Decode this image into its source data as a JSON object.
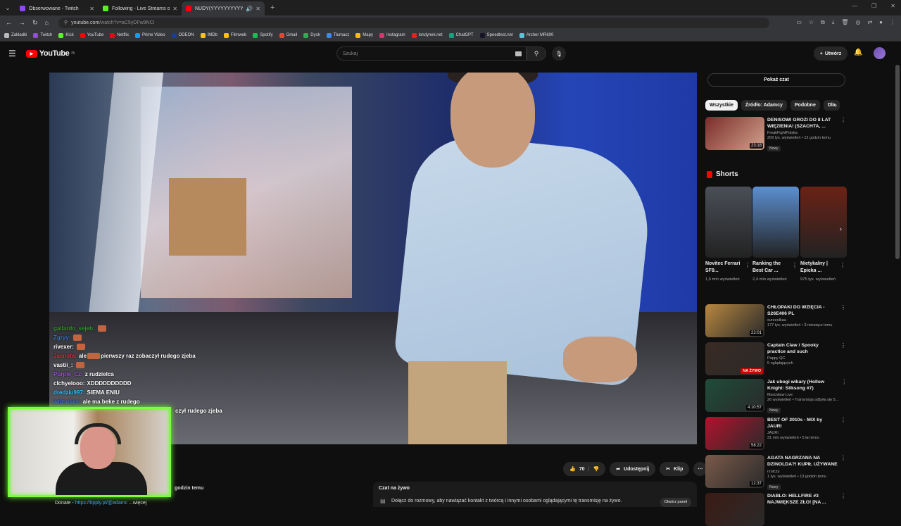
{
  "browser": {
    "tabs": [
      {
        "title": "Obserwowane - Twitch",
        "color": "#9146ff",
        "active": false
      },
      {
        "title": "Following - Live Streams on Kick",
        "color": "#53fc18",
        "active": false
      },
      {
        "title": "NUDY(YYYYYYYYYYY - You",
        "color": "#ff0000",
        "active": true
      }
    ],
    "url_host": "youtube.com",
    "url_path": "/watch?v=aC5yDFw9NCI",
    "bookmarks": [
      {
        "label": "Zakładki",
        "color": "#bbbbbb"
      },
      {
        "label": "Twitch",
        "color": "#9146ff"
      },
      {
        "label": "Kick",
        "color": "#53fc18"
      },
      {
        "label": "YouTube",
        "color": "#ff0000"
      },
      {
        "label": "Netflix",
        "color": "#e50914"
      },
      {
        "label": "Prime Video",
        "color": "#00a8e1"
      },
      {
        "label": "ODEON",
        "color": "#1c3d8f"
      },
      {
        "label": "IMDb",
        "color": "#f5c518"
      },
      {
        "label": "Filmweb",
        "color": "#ffc200"
      },
      {
        "label": "Spotify",
        "color": "#1db954"
      },
      {
        "label": "Gmail",
        "color": "#ea4335"
      },
      {
        "label": "Dysk",
        "color": "#34a853"
      },
      {
        "label": "Tłumacz",
        "color": "#4285f4"
      },
      {
        "label": "Mapy",
        "color": "#fbbc04"
      },
      {
        "label": "Instagram",
        "color": "#e1306c"
      },
      {
        "label": "londynek.net",
        "color": "#e2231a"
      },
      {
        "label": "ChatGPT",
        "color": "#10a37f"
      },
      {
        "label": "Speedtest.net",
        "color": "#141526"
      },
      {
        "label": "Archer MR600",
        "color": "#4acbd6"
      }
    ]
  },
  "youtube": {
    "logo_text": "YouTube",
    "logo_region": "PL",
    "search_placeholder": "Szukaj",
    "create_label": "Utwórz"
  },
  "overlay_chat": [
    {
      "user": "gallardo_sejeb:",
      "color": "#2e9c2e",
      "msg": ""
    },
    {
      "user": "Zgryy:",
      "color": "#3c6fd6",
      "msg": ""
    },
    {
      "user": "rivexer:",
      "color": "#ffffff",
      "msg": ""
    },
    {
      "user": "Jasnota:",
      "color": "#d9303c",
      "msg": "ale",
      "msg2": "pierwszy raz zobaczył rudego zjeba"
    },
    {
      "user": "vastii_:",
      "color": "#ffffff",
      "msg": ""
    },
    {
      "user": "Purple_Cz:",
      "color": "#9b4fd6",
      "msg": "z rudzielca"
    },
    {
      "user": "clchyelooo:",
      "color": "#ffffff",
      "msg": "XDDDDDDDDDD"
    },
    {
      "user": "dredziu997:",
      "color": "#33c0ff",
      "msg": "SIEMA ENIU"
    },
    {
      "user": "wdzudjas:",
      "color": "#3c6fd6",
      "msg": "ale ma beke z rudego"
    },
    {
      "user": "",
      "color": "#ffffff",
      "msg": "czył rudego zjeba"
    }
  ],
  "below_video": {
    "time_text": "godzin temu",
    "donate_label": "Donate -",
    "donate_link": "https://tipply.pl/@adamc",
    "more": "...więcej",
    "likes": "70",
    "share_label": "Udostępnij",
    "clip_label": "Klip",
    "live_chat_title": "Czat na żywo",
    "live_chat_desc": "Dołącz do rozmowy, aby nawiązać kontakt z twórcą i innymi osobami oglądającymi tę transmisję na żywo.",
    "open_panel": "Otwórz panel"
  },
  "sidebar": {
    "show_chat": "Pokaż czat",
    "chips": [
      "Wszystkie",
      "Źródło: Adamcy",
      "Podobne",
      "Dla"
    ],
    "recs_top": [
      {
        "title": "DENISOWI GROZI DO 8 LAT WIĘZIENIA! (SZACHTA, ...",
        "channel": "FreakFightPolska",
        "stats": "209 tys. wyświetleń • 12 godzin temu",
        "badge": "Nowy",
        "duration": "23:18",
        "color": "#7a2c2a"
      }
    ],
    "shorts_title": "Shorts",
    "shorts": [
      {
        "title": "Novitec Ferrari SF9...",
        "views": "1,5 mln wyświetleń",
        "color": "#4a4f57"
      },
      {
        "title": "Ranking the Best Car ...",
        "views": "2,4 mln wyświetleń",
        "color": "#5c8fd0"
      },
      {
        "title": "Nietykalny | Epicka ...",
        "views": "975 tys. wyświetleń",
        "color": "#6b2216"
      }
    ],
    "recs": [
      {
        "title": "CHŁOPAKI DO WZIĘCIA - S26E406 PL",
        "channel": "sureeolkaa",
        "stats": "177 tys. wyświetleń • 3 miesiące temu",
        "badge": "",
        "duration": "22:01",
        "live": "",
        "color": "#b8873f"
      },
      {
        "title": "Captain Claw / Spooky practice and such",
        "channel": "Pappy QC",
        "stats": "5 oglądających",
        "badge": "",
        "duration": "",
        "live": "NA ŻYWO",
        "color": "#3a2a23"
      },
      {
        "title": "Jak ubogi wikary (Hollow Knight: Silksong #7)",
        "channel": "Marcisław Live",
        "stats": "26 wyświetleń • Transmisja odbyła się 5...",
        "badge": "Nowy",
        "duration": "4:10:57",
        "live": "",
        "color": "#1f4c3a"
      },
      {
        "title": "BEST OF 2010s - MIX by JAURI",
        "channel": "JAURI",
        "stats": "31 mln wyświetleń • 5 lat temu",
        "badge": "",
        "duration": "58:22",
        "live": "",
        "color": "#b3122c"
      },
      {
        "title": "AGATA NAGRZANA NA DZINOLDA?! KUPIŁ UŻYWANE ...",
        "channel": "rzutczy",
        "stats": "1 tys. wyświetleń • 13 godzin temu",
        "badge": "Nowy",
        "duration": "12:37",
        "live": "",
        "color": "#7a5a4a"
      },
      {
        "title": "DIABLO: HELLFIRE #3 NAJWIĘKSZE ZŁO! [NA ...",
        "channel": "",
        "stats": "",
        "badge": "",
        "duration": "",
        "live": "",
        "color": "#3c1b14"
      }
    ]
  }
}
